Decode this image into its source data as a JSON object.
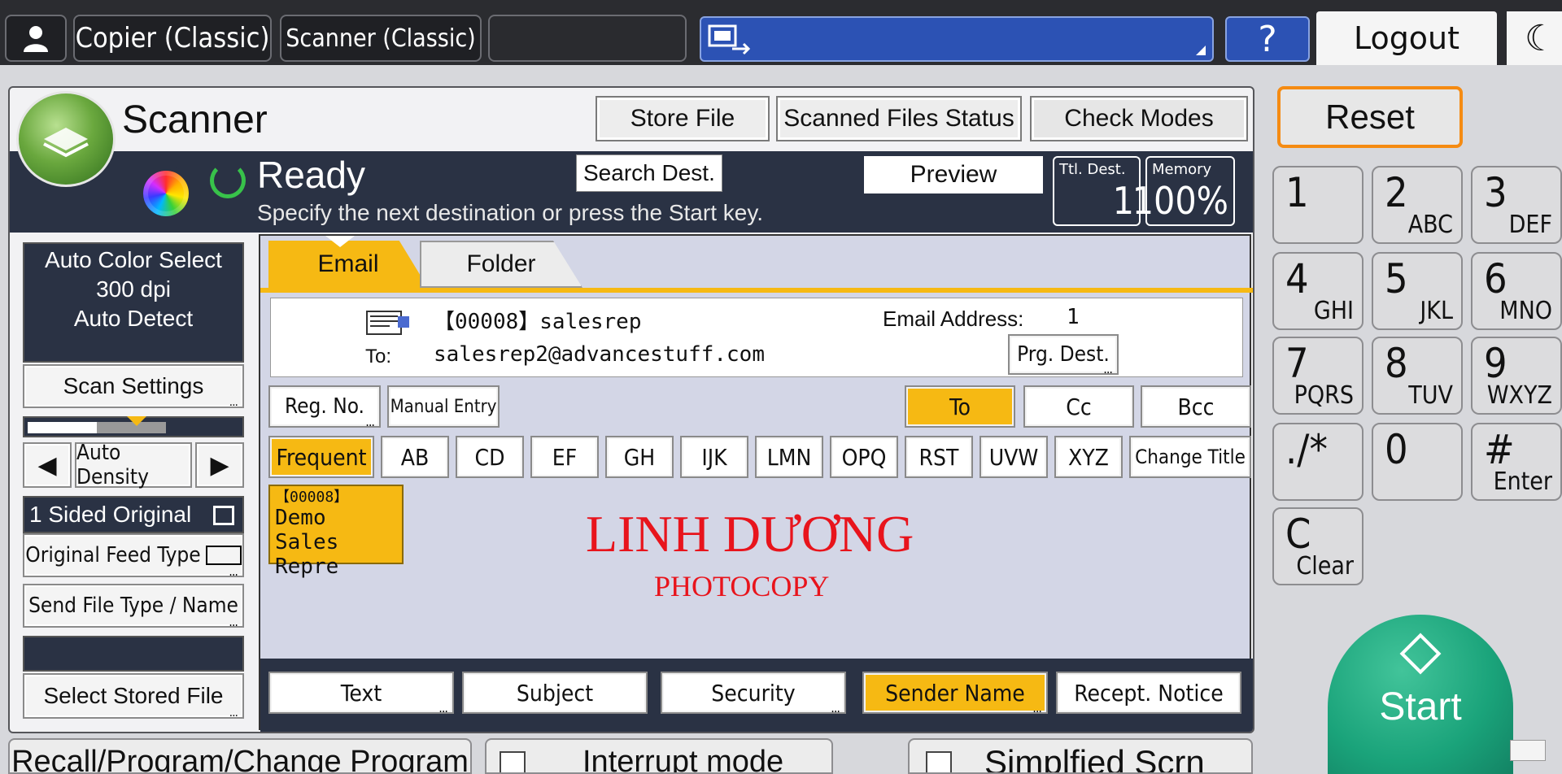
{
  "topbar": {
    "copier_label": "Copier (Classic)",
    "scanner_label": "Scanner (Classic)",
    "help_label": "?",
    "logout_label": "Logout",
    "moon_glyph": "☾",
    "user_icon": "user-icon"
  },
  "header": {
    "title": "Scanner",
    "store_file": "Store File",
    "scanned_status": "Scanned Files Status",
    "check_modes": "Check Modes"
  },
  "status": {
    "ready": "Ready",
    "message": "Specify the next destination or press the Start key.",
    "search_dest": "Search Dest.",
    "preview": "Preview",
    "ttl_label": "Ttl. Dest.",
    "ttl_value": "1",
    "memory_label": "Memory",
    "memory_value": "100%"
  },
  "left": {
    "scan_info": [
      "Auto Color Select",
      "300 dpi",
      "Auto Detect"
    ],
    "scan_settings": "Scan Settings",
    "auto_density": "Auto Density",
    "left_arrow": "◀",
    "right_arrow": "▶",
    "sided": "1 Sided Original",
    "original_feed": "Original Feed Type",
    "send_file_type": "Send File Type / Name",
    "select_stored": "Select Stored File"
  },
  "tabs": {
    "email": "Email",
    "folder": "Folder"
  },
  "destination": {
    "entry": "【00008】salesrep",
    "email_address_label": "Email Address:",
    "email_address_count": "1",
    "to_label": "To:",
    "to_value": "salesrep2@advancestuff.com",
    "prg_dest": "Prg. Dest."
  },
  "buttons": {
    "reg_no": "Reg. No.",
    "manual_entry": "Manual Entry",
    "to": "To",
    "cc": "Cc",
    "bcc": "Bcc",
    "frequent": "Frequent",
    "alpha": [
      "AB",
      "CD",
      "EF",
      "GH",
      "IJK",
      "LMN",
      "OPQ",
      "RST",
      "UVW",
      "XYZ"
    ],
    "change_title": "Change Title"
  },
  "dest_card": {
    "id": "【00008】",
    "line1": "Demo Sales",
    "line2": "Repre"
  },
  "watermark": {
    "line1": "LINH DƯƠNG",
    "line2": "PHOTOCOPY"
  },
  "bottom_buttons": {
    "text": "Text",
    "subject": "Subject",
    "security": "Security",
    "sender_name": "Sender Name",
    "recept_notice": "Recept. Notice"
  },
  "keypad": {
    "reset": "Reset",
    "keys": [
      {
        "num": "1",
        "sub": ""
      },
      {
        "num": "2",
        "sub": "ABC"
      },
      {
        "num": "3",
        "sub": "DEF"
      },
      {
        "num": "4",
        "sub": "GHI"
      },
      {
        "num": "5",
        "sub": "JKL"
      },
      {
        "num": "6",
        "sub": "MNO"
      },
      {
        "num": "7",
        "sub": "PQRS"
      },
      {
        "num": "8",
        "sub": "TUV"
      },
      {
        "num": "9",
        "sub": "WXYZ"
      },
      {
        "num": "./*",
        "sub": ""
      },
      {
        "num": "0",
        "sub": ""
      },
      {
        "num": "#",
        "sub": "Enter"
      },
      {
        "num": "C",
        "sub": "Clear"
      }
    ],
    "start": "Start"
  },
  "bottom_bar": {
    "recall": "Recall/Program/Change Program",
    "interrupt": "Interrupt mode",
    "simplified": "Simplfied Scrn"
  },
  "colors": {
    "accent_yellow": "#f6b913",
    "dark_blue": "#2a3244",
    "start_green": "#1aa37a",
    "reset_orange": "#f58b12"
  }
}
